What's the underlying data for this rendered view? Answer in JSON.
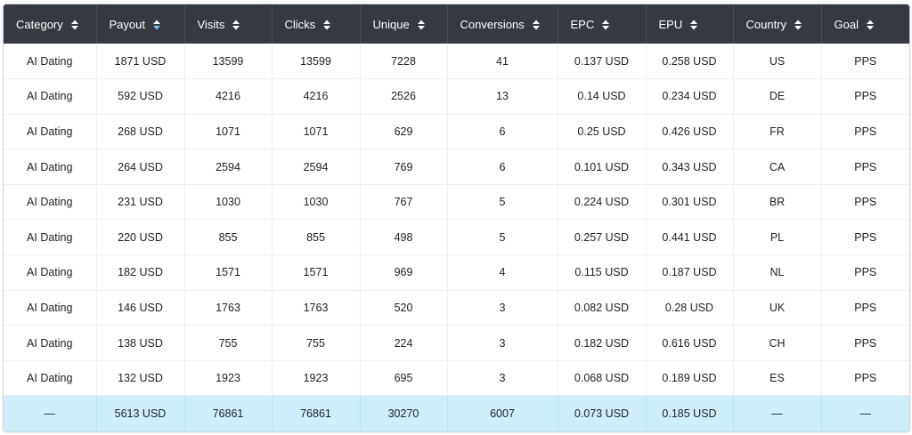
{
  "table": {
    "columns": [
      {
        "label": "Category",
        "sort": "none"
      },
      {
        "label": "Payout",
        "sort": "desc"
      },
      {
        "label": "Visits",
        "sort": "none"
      },
      {
        "label": "Clicks",
        "sort": "none"
      },
      {
        "label": "Unique",
        "sort": "none"
      },
      {
        "label": "Conversions",
        "sort": "none"
      },
      {
        "label": "EPC",
        "sort": "none"
      },
      {
        "label": "EPU",
        "sort": "none"
      },
      {
        "label": "Country",
        "sort": "none"
      },
      {
        "label": "Goal",
        "sort": "none"
      }
    ],
    "rows": [
      [
        "AI Dating",
        "1871 USD",
        "13599",
        "13599",
        "7228",
        "41",
        "0.137 USD",
        "0.258 USD",
        "US",
        "PPS"
      ],
      [
        "AI Dating",
        "592 USD",
        "4216",
        "4216",
        "2526",
        "13",
        "0.14 USD",
        "0.234 USD",
        "DE",
        "PPS"
      ],
      [
        "AI Dating",
        "268 USD",
        "1071",
        "1071",
        "629",
        "6",
        "0.25 USD",
        "0.426 USD",
        "FR",
        "PPS"
      ],
      [
        "AI Dating",
        "264 USD",
        "2594",
        "2594",
        "769",
        "6",
        "0.101 USD",
        "0.343 USD",
        "CA",
        "PPS"
      ],
      [
        "AI Dating",
        "231 USD",
        "1030",
        "1030",
        "767",
        "5",
        "0.224 USD",
        "0.301 USD",
        "BR",
        "PPS"
      ],
      [
        "AI Dating",
        "220 USD",
        "855",
        "855",
        "498",
        "5",
        "0.257 USD",
        "0.441 USD",
        "PL",
        "PPS"
      ],
      [
        "AI Dating",
        "182 USD",
        "1571",
        "1571",
        "969",
        "4",
        "0.115 USD",
        "0.187 USD",
        "NL",
        "PPS"
      ],
      [
        "AI Dating",
        "146 USD",
        "1763",
        "1763",
        "520",
        "3",
        "0.082 USD",
        "0.28 USD",
        "UK",
        "PPS"
      ],
      [
        "AI Dating",
        "138 USD",
        "755",
        "755",
        "224",
        "3",
        "0.182 USD",
        "0.616 USD",
        "CH",
        "PPS"
      ],
      [
        "AI Dating",
        "132 USD",
        "1923",
        "1923",
        "695",
        "3",
        "0.068 USD",
        "0.189 USD",
        "ES",
        "PPS"
      ]
    ],
    "totals": [
      "—",
      "5613 USD",
      "76861",
      "76861",
      "30270",
      "6007",
      "0.073 USD",
      "0.185 USD",
      "—",
      "—"
    ]
  },
  "colors": {
    "header_bg": "#343a40",
    "header_text": "#ffffff",
    "sort_inactive": "#ffffff",
    "sort_active": "#6ec8ee",
    "totals_bg": "#cfeefa"
  },
  "icons": {
    "sort_none": "sort-icon",
    "sort_desc": "sort-desc-icon"
  }
}
